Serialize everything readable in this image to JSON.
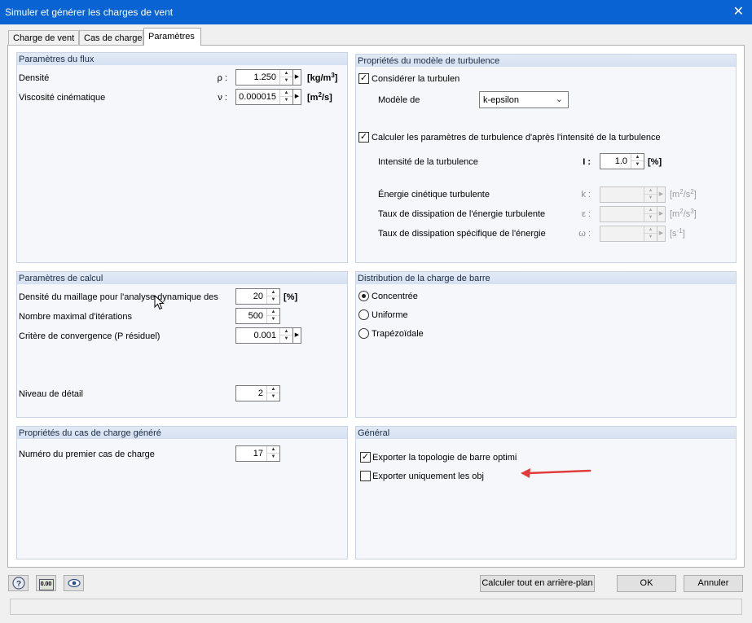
{
  "window": {
    "title": "Simuler et générer les charges de vent",
    "close_glyph": "✕"
  },
  "tabs": [
    {
      "label": "Charge de vent"
    },
    {
      "label": "Cas de charge"
    },
    {
      "label": "Paramètres"
    }
  ],
  "flux": {
    "header": "Paramètres du flux",
    "density": {
      "label": "Densité",
      "symbol": "ρ :",
      "value": "1.250",
      "unit_base": "[kg/m",
      "unit_sup": "3",
      "unit_end": "]"
    },
    "viscosity": {
      "label": "Viscosité cinématique",
      "symbol": "ν :",
      "value": "0.000015",
      "unit_base": "[m",
      "unit_sup": "2",
      "unit_end": "/s]"
    }
  },
  "turbulence": {
    "header": "Propriétés du modèle de turbulence",
    "consider_label": "Considérer la turbulen",
    "consider_checked": true,
    "model_label": "Modèle de",
    "model_value": "k-epsilon",
    "calc_label": "Calculer les paramètres de turbulence d'après l'intensité de la turbulence",
    "calc_checked": true,
    "intensity": {
      "label": "Intensité de la turbulence",
      "symbol": "I :",
      "value": "1.0",
      "unit": "[%]"
    },
    "kinetic": {
      "label": "Énergie cinétique turbulente",
      "symbol": "k :",
      "unit_base": "[m",
      "unit_sup1": "2",
      "unit_mid": "/s",
      "unit_sup2": "2",
      "unit_end": "]"
    },
    "dissipation": {
      "label": "Taux de dissipation de l'énergie turbulente",
      "symbol": "ε :",
      "unit_base": "[m",
      "unit_sup1": "2",
      "unit_mid": "/s",
      "unit_sup2": "3",
      "unit_end": "]"
    },
    "specific": {
      "label": "Taux de dissipation spécifique de l'énergie",
      "symbol": "ω :",
      "unit_base": "[s",
      "unit_sup": "-1",
      "unit_end": "]"
    }
  },
  "calc": {
    "header": "Paramètres de calcul",
    "mesh": {
      "label": "Densité du maillage pour l'analyse dynamique des",
      "value": "20",
      "unit": "[%]"
    },
    "iterations": {
      "label": "Nombre maximal d'itérations",
      "value": "500"
    },
    "convergence": {
      "label": "Critère de convergence (P résiduel)",
      "value": "0.001"
    },
    "detail": {
      "label": "Niveau de détail",
      "value": "2"
    }
  },
  "distribution": {
    "header": "Distribution de la charge de barre",
    "options": [
      {
        "label": "Concentrée",
        "selected": true
      },
      {
        "label": "Uniforme",
        "selected": false
      },
      {
        "label": "Trapézoïdale",
        "selected": false
      }
    ]
  },
  "loadcase": {
    "header": "Propriétés du cas de charge généré",
    "first": {
      "label": "Numéro du premier cas de charge",
      "value": "17"
    }
  },
  "general": {
    "header": "Général",
    "export_topology": {
      "label": "Exporter la topologie de barre optimi",
      "checked": true
    },
    "export_only": {
      "label": "Exporter uniquement les obj",
      "checked": false
    }
  },
  "footer": {
    "calc_background": "Calculer tout en arrière-plan",
    "ok": "OK",
    "cancel": "Annuler",
    "units_icon_text": "0.00"
  },
  "colors": {
    "titlebar": "#0a63d2",
    "group_header": "#d5e0f1",
    "annotation_arrow": "#e03c3c"
  },
  "icons": [
    "help-icon",
    "units-icon",
    "eye-icon",
    "cursor-icon"
  ]
}
